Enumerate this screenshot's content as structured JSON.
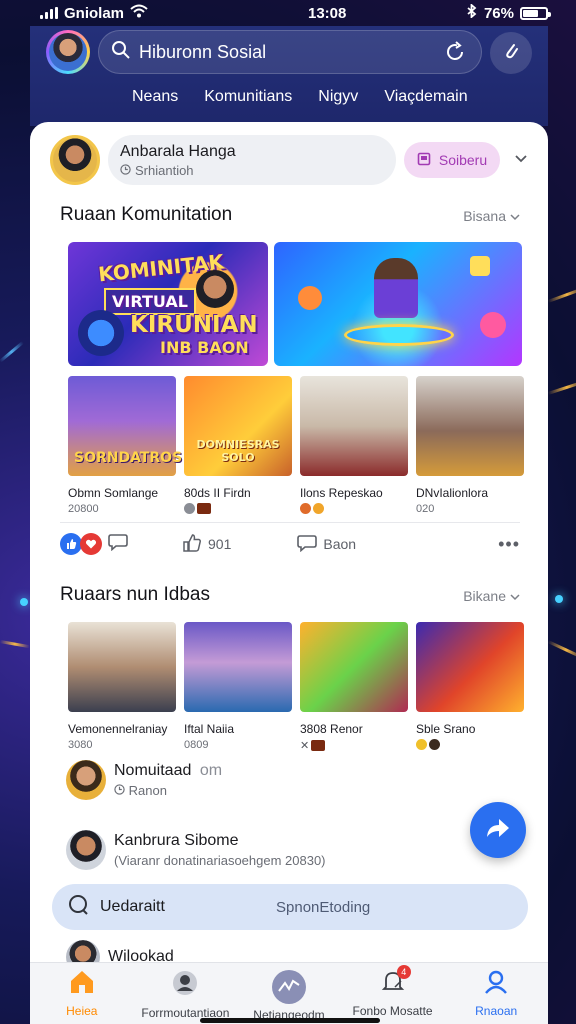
{
  "status_bar": {
    "carrier": "Gniolam",
    "time": "13:08",
    "battery": "76%"
  },
  "header": {
    "search_value": "Hiburonn Sosial",
    "tabs": [
      "Neans",
      "Komunitians",
      "Nigyv",
      "Viaçdemain"
    ]
  },
  "composer": {
    "name": "Anbarala Hanga",
    "sub": "Srhiantioh",
    "submit_label": "Soiberu"
  },
  "section1": {
    "title": "Ruaan Komunitation",
    "more": "Bisana",
    "hero_left_text": [
      "KOMINITAK",
      "VIRTUAL",
      "KIRUNIAN",
      "INB BAON"
    ],
    "thumbs": [
      {
        "title": "Obmn Somlange",
        "sub": "20800",
        "caption": "SORNDATROS"
      },
      {
        "title": "80ds II Firdn",
        "sub": "",
        "caption": "DOMNIESRAS SOLO"
      },
      {
        "title": "Ilons Repeskao",
        "sub": "",
        "caption": ""
      },
      {
        "title": "DNvIalionlora",
        "sub": "020",
        "caption": ""
      }
    ]
  },
  "reactions": {
    "like_count": "901",
    "comment_label": "Baon"
  },
  "section2": {
    "title": "Ruaars nun Idbas",
    "more": "Bikane",
    "thumbs": [
      {
        "title": "Vemonennelraniay",
        "sub": "3080"
      },
      {
        "title": "Iftal Naiia",
        "sub": "0809"
      },
      {
        "title": "3808 Renor",
        "sub": ""
      },
      {
        "title": "Sble Srano",
        "sub": ""
      }
    ]
  },
  "people": [
    {
      "name": "Nomuitaad",
      "extra": "om",
      "sub": "Ranon"
    },
    {
      "name": "Kanbrura Sibome",
      "extra": "",
      "sub": "(Viaranr donatinariasoehgem 20830)"
    }
  ],
  "update_bar": {
    "label": "Uedaraitt",
    "status": "SpnonEtoding"
  },
  "last_person": {
    "name": "Wilookad"
  },
  "bottom_nav": {
    "items": [
      "Heiea",
      "Forrmoutantiaon",
      "Netiangeodm",
      "Fonbo Mosatte",
      "Rnaoan"
    ],
    "badge": "4"
  },
  "colors": {
    "accent": "#2a6ff0",
    "home_active": "#ff8a00",
    "submit_bg": "#f3d9f4"
  }
}
